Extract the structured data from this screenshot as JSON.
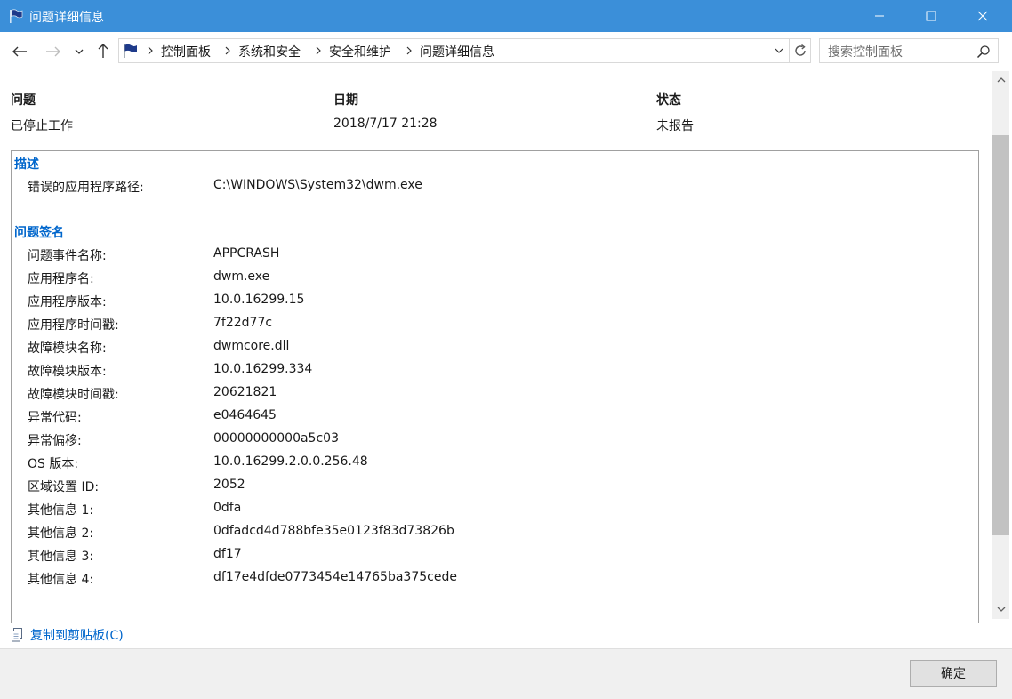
{
  "window": {
    "title": "问题详细信息",
    "icon": "flag-icon",
    "controls": [
      "minimize-icon",
      "maximize-icon",
      "close-icon"
    ]
  },
  "nav": {
    "back_icon": "back-arrow-icon",
    "forward_icon": "forward-arrow-icon",
    "recent_icon": "chevron-down-icon",
    "up_icon": "up-arrow-icon",
    "breadcrumbs": [
      "控制面板",
      "系统和安全",
      "安全和维护",
      "问题详细信息"
    ],
    "refresh_icon": "refresh-icon",
    "search": {
      "placeholder": "搜索控制面板",
      "icon": "search-icon"
    }
  },
  "summary": {
    "headers": [
      "问题",
      "日期",
      "状态"
    ],
    "values": [
      "已停止工作",
      "2018/7/17 21:28",
      "未报告"
    ]
  },
  "description": {
    "title": "描述",
    "rows": [
      {
        "label": "错误的应用程序路径:",
        "value": "C:\\WINDOWS\\System32\\dwm.exe"
      }
    ]
  },
  "signature": {
    "title": "问题签名",
    "rows": [
      {
        "label": "问题事件名称:",
        "value": "APPCRASH"
      },
      {
        "label": "应用程序名:",
        "value": "dwm.exe"
      },
      {
        "label": "应用程序版本:",
        "value": "10.0.16299.15"
      },
      {
        "label": "应用程序时间戳:",
        "value": "7f22d77c"
      },
      {
        "label": "故障模块名称:",
        "value": "dwmcore.dll"
      },
      {
        "label": "故障模块版本:",
        "value": "10.0.16299.334"
      },
      {
        "label": "故障模块时间戳:",
        "value": "20621821"
      },
      {
        "label": "异常代码:",
        "value": "e0464645"
      },
      {
        "label": "异常偏移:",
        "value": "00000000000a5c03"
      },
      {
        "label": "OS 版本:",
        "value": "10.0.16299.2.0.0.256.48"
      },
      {
        "label": "区域设置 ID:",
        "value": "2052"
      },
      {
        "label": "其他信息 1:",
        "value": "0dfa"
      },
      {
        "label": "其他信息 2:",
        "value": "0dfadcd4d788bfe35e0123f83d73826b"
      },
      {
        "label": "其他信息 3:",
        "value": "df17"
      },
      {
        "label": "其他信息 4:",
        "value": "df17e4dfde0773454e14765ba375cede"
      }
    ]
  },
  "copy_link": {
    "label": "复制到剪贴板(C)",
    "icon": "clipboard-icon"
  },
  "ok_button": {
    "label": "确定"
  },
  "colors": {
    "titlebar": "#3b8fd9",
    "link": "#0066cc"
  }
}
